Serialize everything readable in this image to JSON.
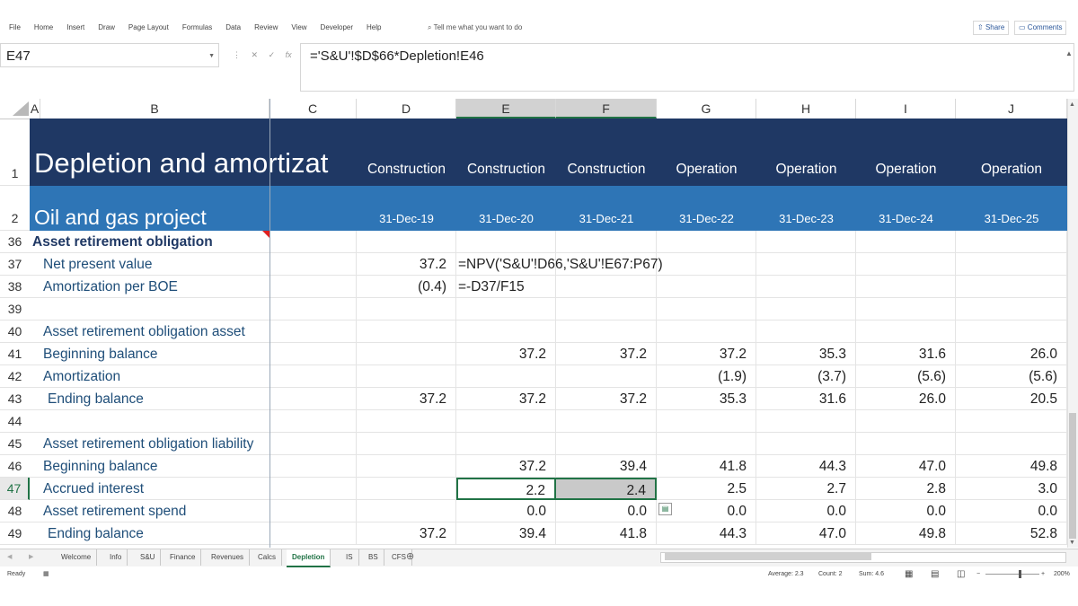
{
  "ribbon": {
    "menus": [
      "File",
      "Home",
      "Insert",
      "Draw",
      "Page Layout",
      "Formulas",
      "Data",
      "Review",
      "View",
      "Developer",
      "Help"
    ],
    "tell_me": "Tell me what you want to do",
    "share": "Share",
    "comments": "Comments"
  },
  "formula_bar": {
    "name_box": "E47",
    "formula": "='S&U'!$D$66*Depletion!E46"
  },
  "columns": [
    "A",
    "B",
    "C",
    "D",
    "E",
    "F",
    "G",
    "H",
    "I",
    "J"
  ],
  "header_rows": {
    "row1": {
      "number": "1",
      "title": "Depletion and amortizat",
      "phases": [
        "Construction",
        "Construction",
        "Construction",
        "Operation",
        "Operation",
        "Operation",
        "Operation"
      ]
    },
    "row2": {
      "number": "2",
      "subtitle": "Oil and gas project",
      "dates": [
        "31-Dec-19",
        "31-Dec-20",
        "31-Dec-21",
        "31-Dec-22",
        "31-Dec-23",
        "31-Dec-24",
        "31-Dec-25"
      ]
    }
  },
  "rows": [
    {
      "n": "36",
      "label": "Asset retirement obligation",
      "bold": true,
      "vals": [
        "",
        "",
        "",
        "",
        "",
        "",
        ""
      ]
    },
    {
      "n": "37",
      "label": "Net present value",
      "vals": [
        "37.2",
        "=NPV('S&U'!D66,'S&U'!E67:P67)",
        "",
        "",
        "",
        "",
        ""
      ]
    },
    {
      "n": "38",
      "label": "Amortization per BOE",
      "vals": [
        "(0.4)",
        "=-D37/F15",
        "",
        "",
        "",
        "",
        ""
      ]
    },
    {
      "n": "39",
      "label": "",
      "vals": [
        "",
        "",
        "",
        "",
        "",
        "",
        ""
      ]
    },
    {
      "n": "40",
      "label": "Asset retirement obligation asset",
      "vals": [
        "",
        "",
        "",
        "",
        "",
        "",
        ""
      ]
    },
    {
      "n": "41",
      "label": "Beginning balance",
      "vals": [
        "",
        "37.2",
        "37.2",
        "37.2",
        "35.3",
        "31.6",
        "26.0"
      ]
    },
    {
      "n": "42",
      "label": "Amortization",
      "vals": [
        "",
        "",
        "",
        "(1.9)",
        "(3.7)",
        "(5.6)",
        "(5.6)"
      ]
    },
    {
      "n": "43",
      "label": "Ending balance",
      "indent": true,
      "vals": [
        "37.2",
        "37.2",
        "37.2",
        "35.3",
        "31.6",
        "26.0",
        "20.5"
      ]
    },
    {
      "n": "44",
      "label": "",
      "vals": [
        "",
        "",
        "",
        "",
        "",
        "",
        ""
      ]
    },
    {
      "n": "45",
      "label": "Asset retirement obligation liability",
      "vals": [
        "",
        "",
        "",
        "",
        "",
        "",
        ""
      ]
    },
    {
      "n": "46",
      "label": "Beginning balance",
      "vals": [
        "",
        "37.2",
        "39.4",
        "41.8",
        "44.3",
        "47.0",
        "49.8"
      ]
    },
    {
      "n": "47",
      "label": "Accrued interest",
      "vals": [
        "",
        "2.2",
        "2.4",
        "2.5",
        "2.7",
        "2.8",
        "3.0"
      ]
    },
    {
      "n": "48",
      "label": "Asset retirement spend",
      "vals": [
        "",
        "0.0",
        "0.0",
        "0.0",
        "0.0",
        "0.0",
        "0.0"
      ]
    },
    {
      "n": "49",
      "label": "Ending balance",
      "indent": true,
      "vals": [
        "37.2",
        "39.4",
        "41.8",
        "44.3",
        "47.0",
        "49.8",
        "52.8"
      ]
    }
  ],
  "sheet_tabs": [
    "Welcome",
    "Info",
    "S&U",
    "Finance",
    "Revenues",
    "Calcs",
    "Depletion",
    "IS",
    "BS",
    "CFS"
  ],
  "active_tab": "Depletion",
  "status": {
    "ready": "Ready",
    "average": "Average: 2.3",
    "count": "Count: 2",
    "sum": "Sum: 4.6",
    "zoom": "200%"
  },
  "colors": {
    "header_dark": "#1f3864",
    "header_blue": "#2e75b6",
    "label_blue": "#1f4e79",
    "excel_green": "#217346"
  }
}
